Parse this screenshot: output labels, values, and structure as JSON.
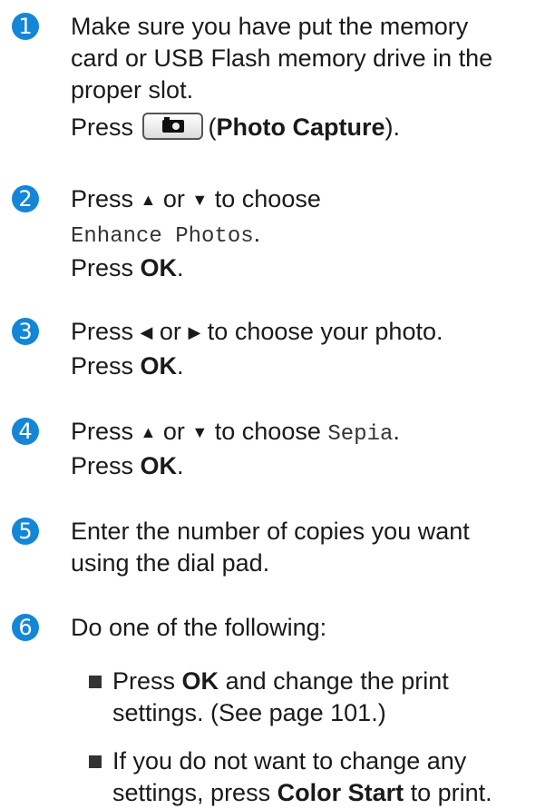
{
  "steps": [
    {
      "number": "1",
      "line1": "Make sure you have put the memory",
      "line2": "card or USB Flash memory drive in the",
      "line3": "proper slot.",
      "press_word": "Press",
      "button_name": "Photo Capture",
      "paren_open": "(",
      "paren_close": ")."
    },
    {
      "number": "2",
      "press_word": "Press",
      "up_arrow": "▲",
      "or_word": "or",
      "down_arrow": "▼",
      "to_choose": "to choose",
      "menu_item": "Enhance Photos",
      "period": ".",
      "press_ok_word": "Press",
      "ok": "OK",
      "ok_period": "."
    },
    {
      "number": "3",
      "press_word": "Press",
      "left_arrow": "◀",
      "or_word": "or",
      "right_arrow": "▶",
      "text": "to choose your photo.",
      "press_ok_word": "Press",
      "ok": "OK",
      "ok_period": "."
    },
    {
      "number": "4",
      "press_word": "Press",
      "up_arrow": "▲",
      "or_word": "or",
      "down_arrow": "▼",
      "to_choose": "to choose",
      "menu_item": "Sepia",
      "period": ".",
      "press_ok_word": "Press",
      "ok": "OK",
      "ok_period": "."
    },
    {
      "number": "5",
      "line1": "Enter the number of copies you want",
      "line2": "using the dial pad."
    },
    {
      "number": "6",
      "text": "Do one of the following:",
      "bullets": [
        {
          "pre": "Press",
          "bold": "OK",
          "post": "and change the print",
          "line2": "settings. (See page 101.)"
        },
        {
          "line1": "If you do not want to change any",
          "pre2": "settings, press",
          "bold": "Color Start",
          "post2": "to print."
        }
      ]
    }
  ],
  "colors": {
    "step_badge": "#1486d8",
    "text": "#1a1a1a"
  },
  "icons": {
    "step_badge": "circle-number",
    "photo_capture_button": "camera-icon",
    "bullet": "square-bullet"
  }
}
